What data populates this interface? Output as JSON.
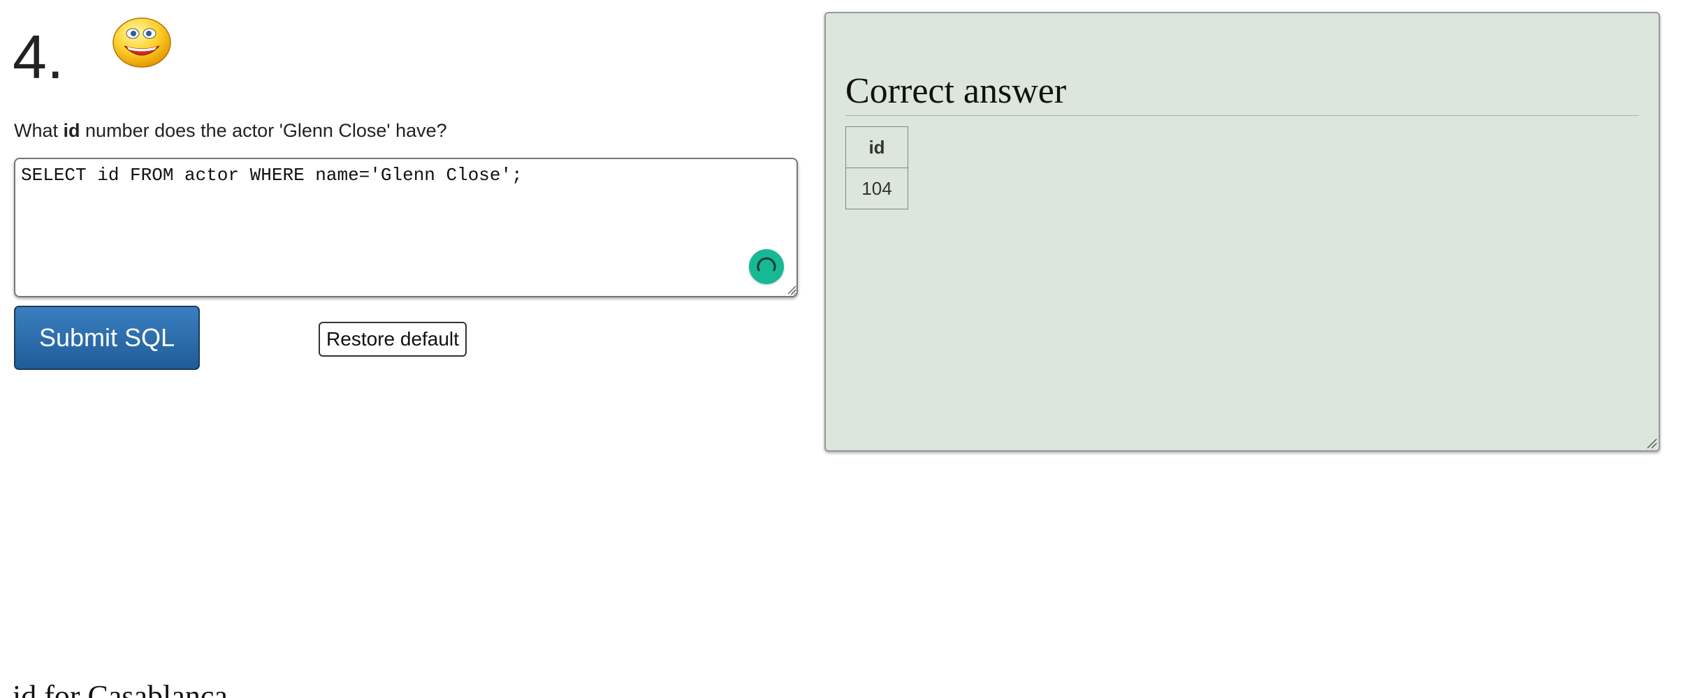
{
  "question": {
    "number": "4.",
    "prompt_before": "What ",
    "prompt_bold": "id",
    "prompt_after": " number does the actor 'Glenn Close' have?"
  },
  "editor": {
    "value": "SELECT id FROM actor WHERE name='Glenn Close';"
  },
  "buttons": {
    "submit_label": "Submit SQL",
    "restore_label": "Restore default"
  },
  "answer": {
    "title": "Correct answer",
    "columns": [
      "id"
    ],
    "rows": [
      [
        "104"
      ]
    ]
  },
  "next_section": {
    "heading": "id for Casablanca"
  },
  "colors": {
    "accent_blue": "#205c98",
    "spinner_green": "#17b894",
    "answer_panel_bg": "#dce6dc"
  },
  "icons": {
    "status": "smiley-face-icon",
    "assistant": "loading-spinner-icon"
  }
}
